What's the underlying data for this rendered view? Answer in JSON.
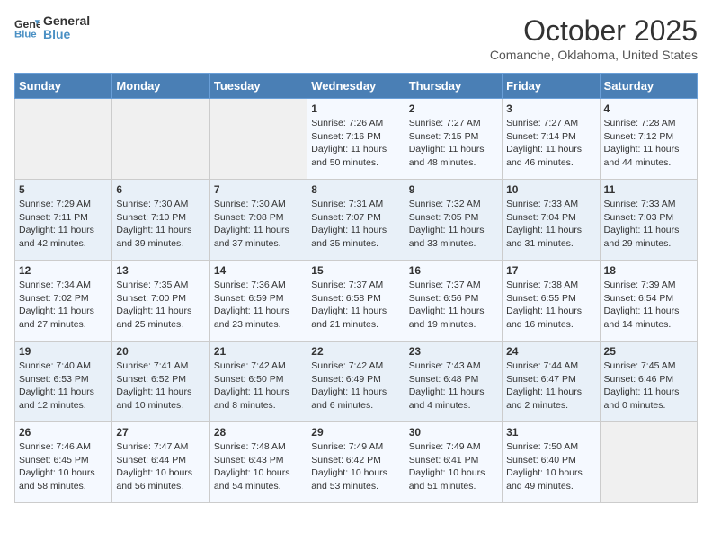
{
  "logo": {
    "line1": "General",
    "line2": "Blue"
  },
  "title": "October 2025",
  "location": "Comanche, Oklahoma, United States",
  "days_of_week": [
    "Sunday",
    "Monday",
    "Tuesday",
    "Wednesday",
    "Thursday",
    "Friday",
    "Saturday"
  ],
  "weeks": [
    [
      {
        "num": "",
        "sunrise": "",
        "sunset": "",
        "daylight": ""
      },
      {
        "num": "",
        "sunrise": "",
        "sunset": "",
        "daylight": ""
      },
      {
        "num": "",
        "sunrise": "",
        "sunset": "",
        "daylight": ""
      },
      {
        "num": "1",
        "sunrise": "Sunrise: 7:26 AM",
        "sunset": "Sunset: 7:16 PM",
        "daylight": "Daylight: 11 hours and 50 minutes."
      },
      {
        "num": "2",
        "sunrise": "Sunrise: 7:27 AM",
        "sunset": "Sunset: 7:15 PM",
        "daylight": "Daylight: 11 hours and 48 minutes."
      },
      {
        "num": "3",
        "sunrise": "Sunrise: 7:27 AM",
        "sunset": "Sunset: 7:14 PM",
        "daylight": "Daylight: 11 hours and 46 minutes."
      },
      {
        "num": "4",
        "sunrise": "Sunrise: 7:28 AM",
        "sunset": "Sunset: 7:12 PM",
        "daylight": "Daylight: 11 hours and 44 minutes."
      }
    ],
    [
      {
        "num": "5",
        "sunrise": "Sunrise: 7:29 AM",
        "sunset": "Sunset: 7:11 PM",
        "daylight": "Daylight: 11 hours and 42 minutes."
      },
      {
        "num": "6",
        "sunrise": "Sunrise: 7:30 AM",
        "sunset": "Sunset: 7:10 PM",
        "daylight": "Daylight: 11 hours and 39 minutes."
      },
      {
        "num": "7",
        "sunrise": "Sunrise: 7:30 AM",
        "sunset": "Sunset: 7:08 PM",
        "daylight": "Daylight: 11 hours and 37 minutes."
      },
      {
        "num": "8",
        "sunrise": "Sunrise: 7:31 AM",
        "sunset": "Sunset: 7:07 PM",
        "daylight": "Daylight: 11 hours and 35 minutes."
      },
      {
        "num": "9",
        "sunrise": "Sunrise: 7:32 AM",
        "sunset": "Sunset: 7:05 PM",
        "daylight": "Daylight: 11 hours and 33 minutes."
      },
      {
        "num": "10",
        "sunrise": "Sunrise: 7:33 AM",
        "sunset": "Sunset: 7:04 PM",
        "daylight": "Daylight: 11 hours and 31 minutes."
      },
      {
        "num": "11",
        "sunrise": "Sunrise: 7:33 AM",
        "sunset": "Sunset: 7:03 PM",
        "daylight": "Daylight: 11 hours and 29 minutes."
      }
    ],
    [
      {
        "num": "12",
        "sunrise": "Sunrise: 7:34 AM",
        "sunset": "Sunset: 7:02 PM",
        "daylight": "Daylight: 11 hours and 27 minutes."
      },
      {
        "num": "13",
        "sunrise": "Sunrise: 7:35 AM",
        "sunset": "Sunset: 7:00 PM",
        "daylight": "Daylight: 11 hours and 25 minutes."
      },
      {
        "num": "14",
        "sunrise": "Sunrise: 7:36 AM",
        "sunset": "Sunset: 6:59 PM",
        "daylight": "Daylight: 11 hours and 23 minutes."
      },
      {
        "num": "15",
        "sunrise": "Sunrise: 7:37 AM",
        "sunset": "Sunset: 6:58 PM",
        "daylight": "Daylight: 11 hours and 21 minutes."
      },
      {
        "num": "16",
        "sunrise": "Sunrise: 7:37 AM",
        "sunset": "Sunset: 6:56 PM",
        "daylight": "Daylight: 11 hours and 19 minutes."
      },
      {
        "num": "17",
        "sunrise": "Sunrise: 7:38 AM",
        "sunset": "Sunset: 6:55 PM",
        "daylight": "Daylight: 11 hours and 16 minutes."
      },
      {
        "num": "18",
        "sunrise": "Sunrise: 7:39 AM",
        "sunset": "Sunset: 6:54 PM",
        "daylight": "Daylight: 11 hours and 14 minutes."
      }
    ],
    [
      {
        "num": "19",
        "sunrise": "Sunrise: 7:40 AM",
        "sunset": "Sunset: 6:53 PM",
        "daylight": "Daylight: 11 hours and 12 minutes."
      },
      {
        "num": "20",
        "sunrise": "Sunrise: 7:41 AM",
        "sunset": "Sunset: 6:52 PM",
        "daylight": "Daylight: 11 hours and 10 minutes."
      },
      {
        "num": "21",
        "sunrise": "Sunrise: 7:42 AM",
        "sunset": "Sunset: 6:50 PM",
        "daylight": "Daylight: 11 hours and 8 minutes."
      },
      {
        "num": "22",
        "sunrise": "Sunrise: 7:42 AM",
        "sunset": "Sunset: 6:49 PM",
        "daylight": "Daylight: 11 hours and 6 minutes."
      },
      {
        "num": "23",
        "sunrise": "Sunrise: 7:43 AM",
        "sunset": "Sunset: 6:48 PM",
        "daylight": "Daylight: 11 hours and 4 minutes."
      },
      {
        "num": "24",
        "sunrise": "Sunrise: 7:44 AM",
        "sunset": "Sunset: 6:47 PM",
        "daylight": "Daylight: 11 hours and 2 minutes."
      },
      {
        "num": "25",
        "sunrise": "Sunrise: 7:45 AM",
        "sunset": "Sunset: 6:46 PM",
        "daylight": "Daylight: 11 hours and 0 minutes."
      }
    ],
    [
      {
        "num": "26",
        "sunrise": "Sunrise: 7:46 AM",
        "sunset": "Sunset: 6:45 PM",
        "daylight": "Daylight: 10 hours and 58 minutes."
      },
      {
        "num": "27",
        "sunrise": "Sunrise: 7:47 AM",
        "sunset": "Sunset: 6:44 PM",
        "daylight": "Daylight: 10 hours and 56 minutes."
      },
      {
        "num": "28",
        "sunrise": "Sunrise: 7:48 AM",
        "sunset": "Sunset: 6:43 PM",
        "daylight": "Daylight: 10 hours and 54 minutes."
      },
      {
        "num": "29",
        "sunrise": "Sunrise: 7:49 AM",
        "sunset": "Sunset: 6:42 PM",
        "daylight": "Daylight: 10 hours and 53 minutes."
      },
      {
        "num": "30",
        "sunrise": "Sunrise: 7:49 AM",
        "sunset": "Sunset: 6:41 PM",
        "daylight": "Daylight: 10 hours and 51 minutes."
      },
      {
        "num": "31",
        "sunrise": "Sunrise: 7:50 AM",
        "sunset": "Sunset: 6:40 PM",
        "daylight": "Daylight: 10 hours and 49 minutes."
      },
      {
        "num": "",
        "sunrise": "",
        "sunset": "",
        "daylight": ""
      }
    ]
  ]
}
